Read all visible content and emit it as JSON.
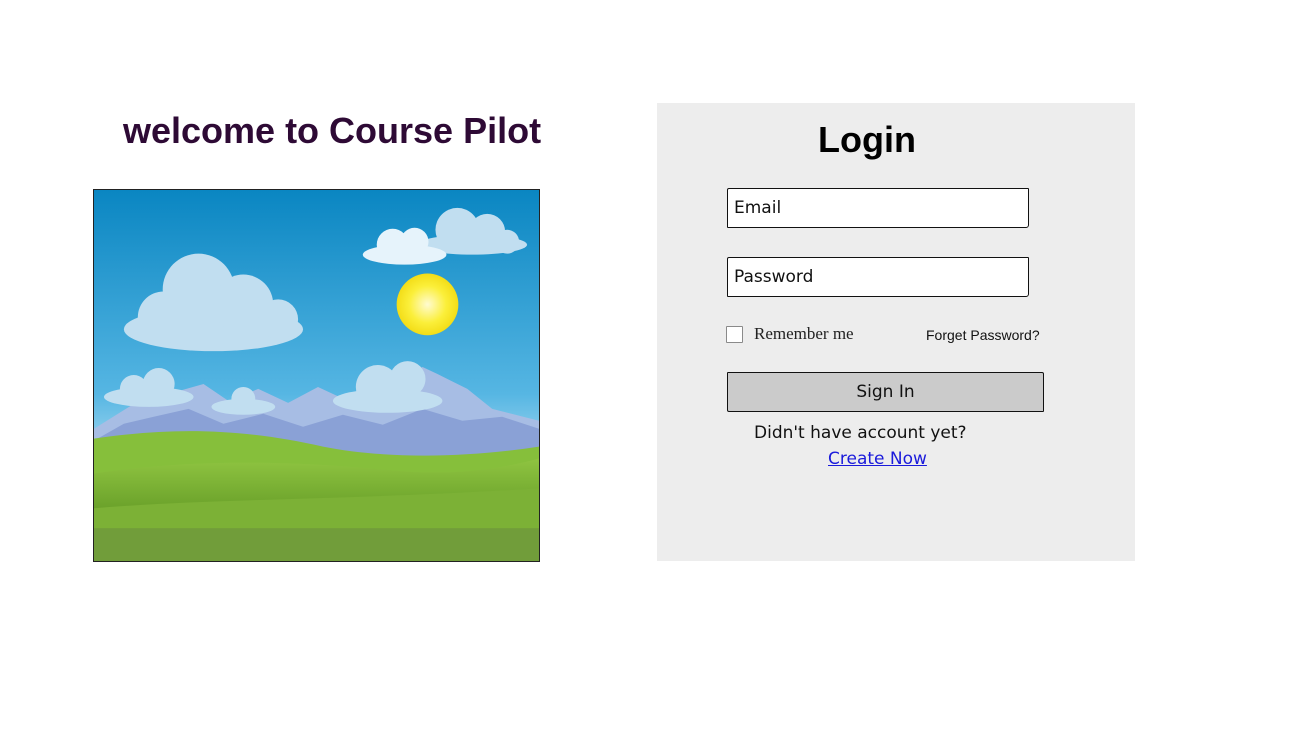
{
  "welcome": {
    "title": "welcome to Course Pilot"
  },
  "login": {
    "title": "Login",
    "email_placeholder": "Email",
    "password_placeholder": "Password",
    "remember_label": "Remember me",
    "remember_checked": false,
    "forget_label": "Forget Password?",
    "signin_label": "Sign In",
    "no_account_text": "Didn't have account yet?",
    "create_label": "Create Now"
  },
  "colors": {
    "title": "#2e0a35",
    "panel_bg": "#ededed",
    "button_bg": "#cbcbcb",
    "link": "#1a1adb"
  },
  "hero_image": {
    "description_icon": "landscape-image"
  }
}
